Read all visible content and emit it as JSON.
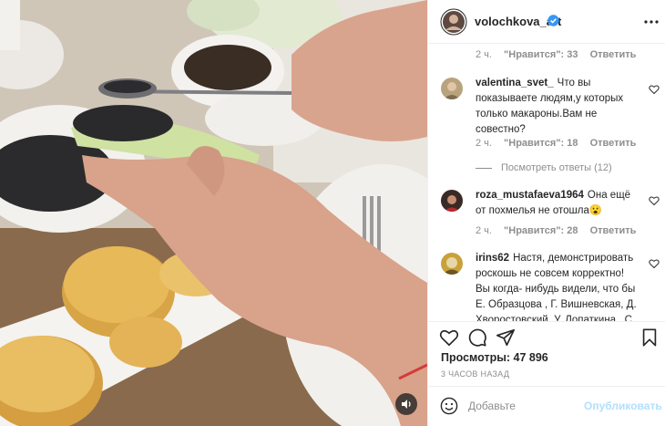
{
  "post": {
    "author": "volochkova_art",
    "verified": true,
    "media_type": "video",
    "sound_icon": "speaker-icon"
  },
  "comments": {
    "first_meta": {
      "time": "2 ч.",
      "likes": "\"Нравится\": 33",
      "reply": "Ответить"
    },
    "items": [
      {
        "username": "valentina_svet_",
        "text": "Что вы показываете людям,у которых только макароны.Вам не совестно?",
        "time": "2 ч.",
        "likes": "\"Нравится\": 18",
        "reply": "Ответить",
        "view_replies": "Посмотреть ответы (12)"
      },
      {
        "username": "roza_mustafaeva1964",
        "text": "Она ещё от похмелья не отошла😮",
        "time": "2 ч.",
        "likes": "\"Нравится\": 28",
        "reply": "Ответить"
      },
      {
        "username": "irins62",
        "text": "Настя, демонстрировать роскошь не совсем корректно! Вы когда- нибудь видели, что бы Е. Образцова , Г. Вишневская, Д. Хворостовский, У. Лопаткина , С."
      }
    ]
  },
  "actions": {
    "like": "heart-icon",
    "comment": "comment-icon",
    "share": "send-icon",
    "save": "bookmark-icon"
  },
  "stats": {
    "views": "Просмотры: 47 896",
    "time_ago": "3 ЧАСОВ НАЗАД"
  },
  "add_comment": {
    "placeholder": "Добавьте",
    "publish_label": "Опубликовать"
  },
  "colors": {
    "verified": "#3897f0",
    "publish_disabled": "#b2dffc",
    "secondary_text": "#8e8e8e"
  }
}
